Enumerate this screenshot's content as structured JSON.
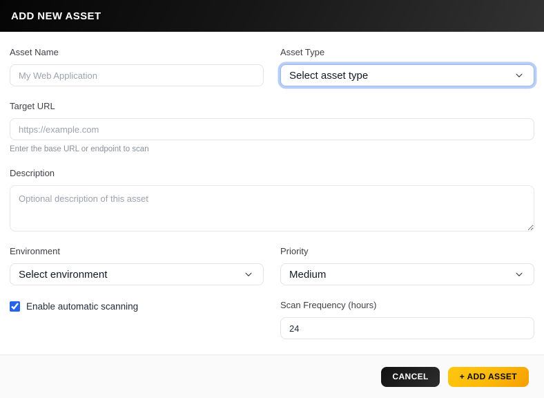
{
  "header": {
    "title": "ADD NEW ASSET"
  },
  "form": {
    "asset_name": {
      "label": "Asset Name",
      "placeholder": "My Web Application"
    },
    "asset_type": {
      "label": "Asset Type",
      "value": "Select asset type",
      "focused": true
    },
    "target_url": {
      "label": "Target URL",
      "placeholder": "https://example.com",
      "helper": "Enter the base URL or endpoint to scan"
    },
    "description": {
      "label": "Description",
      "placeholder": "Optional description of this asset"
    },
    "environment": {
      "label": "Environment",
      "value": "Select environment"
    },
    "priority": {
      "label": "Priority",
      "value": "Medium"
    },
    "auto_scan": {
      "label": "Enable automatic scanning",
      "checked": true
    },
    "scan_frequency": {
      "label": "Scan Frequency (hours)",
      "value": "24"
    }
  },
  "footer": {
    "cancel_label": "CANCEL",
    "add_label": "+ ADD ASSET"
  },
  "colors": {
    "header_bg_start": "#050505",
    "header_bg_end": "#323232",
    "focus_ring_blue": "#6092f2",
    "checkbox_blue": "#2563eb",
    "accent_yellow_start": "#ffc70f",
    "accent_yellow_end": "#f59e00",
    "cancel_black": "#121212",
    "footer_bg": "#fafafa"
  }
}
